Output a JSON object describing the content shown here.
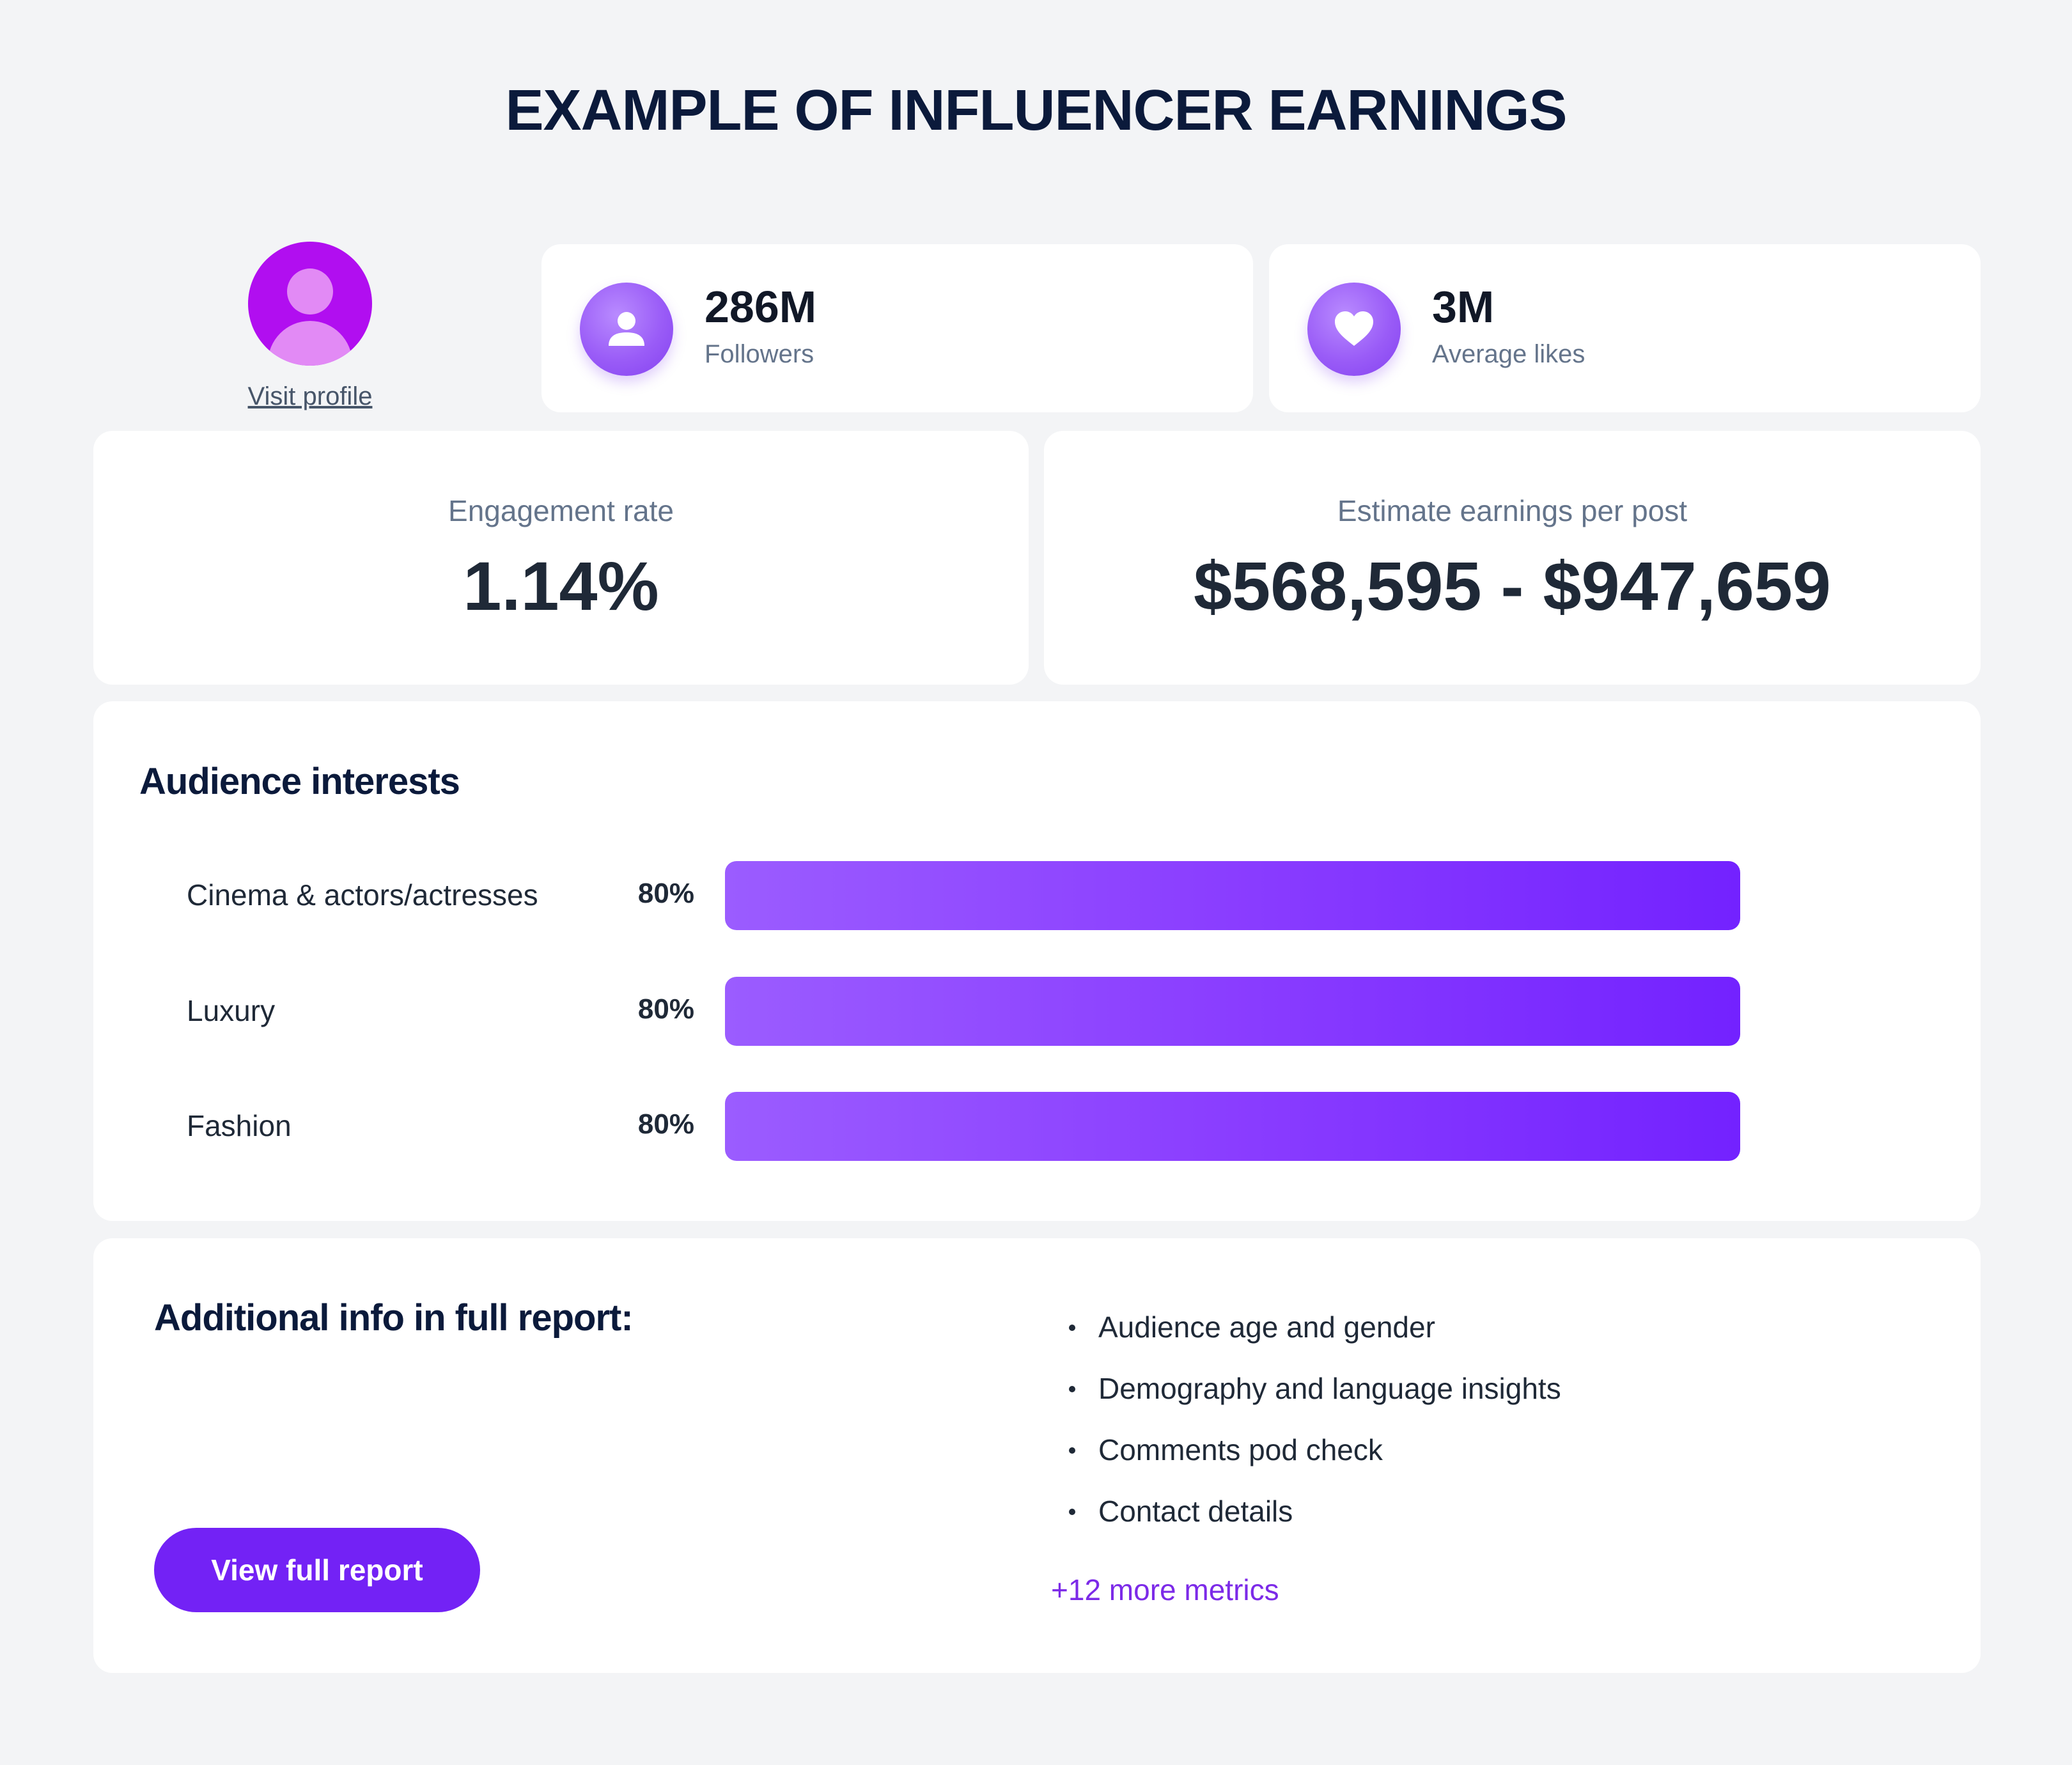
{
  "title": "EXAMPLE OF INFLUENCER EARNINGS",
  "profile": {
    "avatar_icon": "user-avatar-icon",
    "link_label": "Visit profile"
  },
  "stats": [
    {
      "icon": "user-icon",
      "value": "286M",
      "label": "Followers"
    },
    {
      "icon": "heart-icon",
      "value": "3M",
      "label": "Average likes"
    }
  ],
  "metrics": {
    "engagement": {
      "label": "Engagement rate",
      "value": "1.14%"
    },
    "earnings": {
      "label": "Estimate earnings per post",
      "value": "$568,595 - $947,659"
    }
  },
  "interests": {
    "title": "Audience interests",
    "items": [
      {
        "name": "Cinema & actors/actresses",
        "percent_label": "80%",
        "percent": 80
      },
      {
        "name": "Luxury",
        "percent_label": "80%",
        "percent": 80
      },
      {
        "name": "Fashion",
        "percent_label": "80%",
        "percent": 80
      }
    ]
  },
  "additional": {
    "title": "Additional info in full report:",
    "items": [
      "Audience age and gender",
      "Demography and language insights",
      "Comments pod check",
      "Contact details"
    ],
    "more_label": "+12 more metrics",
    "button_label": "View full report"
  },
  "colors": {
    "accent": "#7322f5",
    "avatar": "#b10ef0",
    "link": "#7c2ae8",
    "title": "#0b1a3b"
  }
}
